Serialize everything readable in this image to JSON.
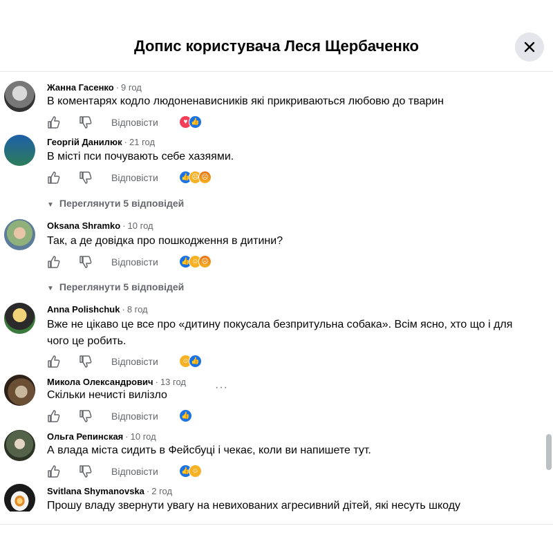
{
  "header": {
    "title": "Допис користувача Леся Щербаченко"
  },
  "actions": {
    "reply_label": "Відповісти"
  },
  "comments": [
    {
      "author": "Жанна Гасенко",
      "time": "9 год",
      "text": "В коментарях кодло людоненависників які прикриваються любовю до тварин",
      "reactions": [
        "love",
        "like"
      ]
    },
    {
      "author": "Георгій Данилюк",
      "time": "21 год",
      "text": "В місті пси почувають себе хазяями.",
      "reactions": [
        "like",
        "sad",
        "angry"
      ],
      "replies_label": "Переглянути 5 відповідей"
    },
    {
      "author": "Oksana Shramko",
      "time": "10 год",
      "text": "Так, а де довідка про пошкодження в дитини?",
      "reactions": [
        "like",
        "haha",
        "angry"
      ],
      "replies_label": "Переглянути 5 відповідей"
    },
    {
      "author": "Anna Polishchuk",
      "time": "8 год",
      "text": "Вже не цікаво це все про «дитину покусала безпритульна собака». Всім ясно, хто що і для чого це робить.",
      "reactions": [
        "haha",
        "like"
      ]
    },
    {
      "author": "Микола Олександрович",
      "time": "13 год",
      "text": "Скільки нечисті вилізло",
      "reactions": [
        "like"
      ]
    },
    {
      "author": "Ольга Репинская",
      "time": "10 год",
      "text": "А влада міста сидить в Фейсбуці і чекає, коли ви напишете тут.",
      "reactions": [
        "like",
        "haha"
      ]
    },
    {
      "author": "Svitlana Shymanovska",
      "time": "2 год",
      "text": "Прошу владу звернути увагу на невихованих агресивний дітей, які несуть шкоду"
    }
  ],
  "icons": {
    "close": "close-icon",
    "like": "thumbs-up-icon",
    "dislike": "thumbs-down-icon",
    "more": "more-options-icon"
  },
  "colors": {
    "like": "#1b74e4",
    "love": "#f33e58",
    "haha": "#f7b125",
    "muted_text": "#65676b"
  }
}
